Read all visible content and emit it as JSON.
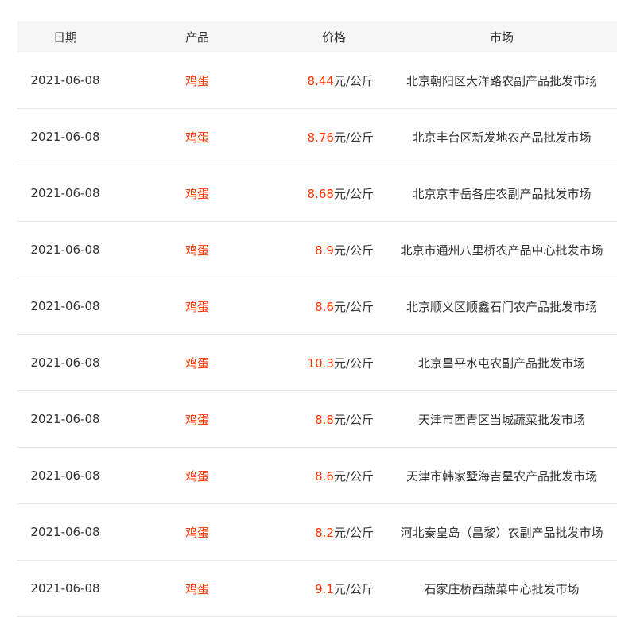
{
  "headers": {
    "date": "日期",
    "product": "产品",
    "price": "价格",
    "market": "市场"
  },
  "rows": [
    {
      "date": "2021-06-08",
      "product": "鸡蛋",
      "price": "8.44",
      "unit": "元/公斤",
      "market": "北京朝阳区大洋路农副产品批发市场"
    },
    {
      "date": "2021-06-08",
      "product": "鸡蛋",
      "price": "8.76",
      "unit": "元/公斤",
      "market": "北京丰台区新发地农产品批发市场"
    },
    {
      "date": "2021-06-08",
      "product": "鸡蛋",
      "price": "8.68",
      "unit": "元/公斤",
      "market": "北京京丰岳各庄农副产品批发市场"
    },
    {
      "date": "2021-06-08",
      "product": "鸡蛋",
      "price": "8.9",
      "unit": "元/公斤",
      "market": "北京市通州八里桥农产品中心批发市场"
    },
    {
      "date": "2021-06-08",
      "product": "鸡蛋",
      "price": "8.6",
      "unit": "元/公斤",
      "market": "北京顺义区顺鑫石门农产品批发市场"
    },
    {
      "date": "2021-06-08",
      "product": "鸡蛋",
      "price": "10.3",
      "unit": "元/公斤",
      "market": "北京昌平水屯农副产品批发市场"
    },
    {
      "date": "2021-06-08",
      "product": "鸡蛋",
      "price": "8.8",
      "unit": "元/公斤",
      "market": "天津市西青区当城蔬菜批发市场"
    },
    {
      "date": "2021-06-08",
      "product": "鸡蛋",
      "price": "8.6",
      "unit": "元/公斤",
      "market": "天津市韩家墅海吉星农产品批发市场"
    },
    {
      "date": "2021-06-08",
      "product": "鸡蛋",
      "price": "8.2",
      "unit": "元/公斤",
      "market": "河北秦皇岛（昌黎）农副产品批发市场"
    },
    {
      "date": "2021-06-08",
      "product": "鸡蛋",
      "price": "9.1",
      "unit": "元/公斤",
      "market": "石家庄桥西蔬菜中心批发市场"
    }
  ],
  "colors": {
    "highlight": "#ff3300",
    "text": "#333333",
    "header_bg": "#f5f5f5",
    "row_border": "#e8e8e8"
  }
}
